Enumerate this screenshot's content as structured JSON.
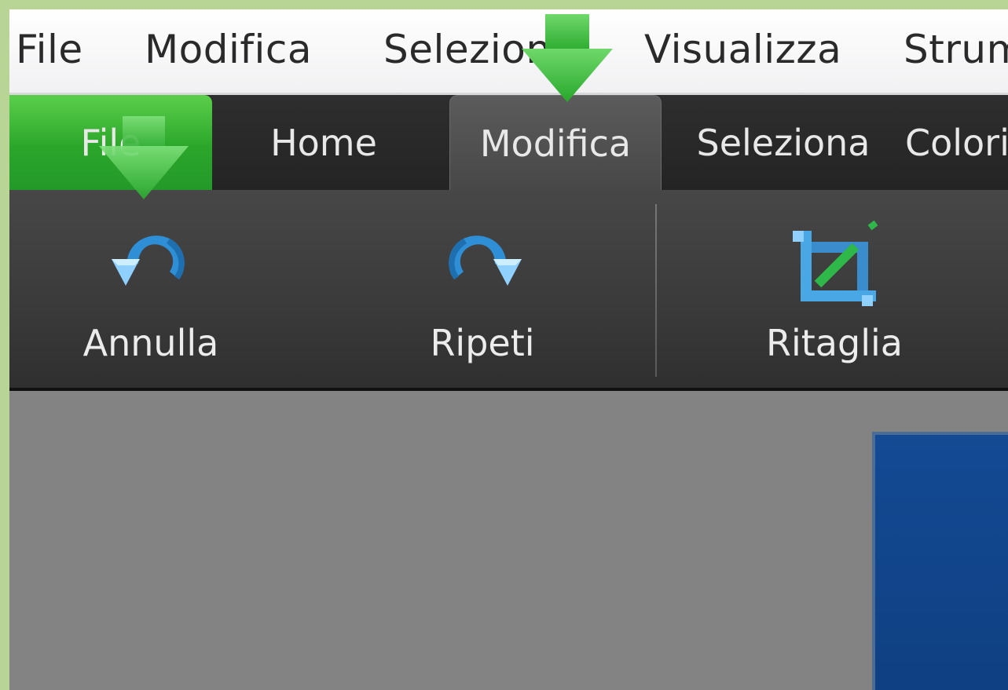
{
  "menubar": {
    "items": [
      "File",
      "Modifica",
      "Seleziona",
      "Visualizza",
      "Strumenti"
    ]
  },
  "ribbon_tabs": [
    "File",
    "Home",
    "Modifica",
    "Seleziona",
    "Colori"
  ],
  "active_tab": "Modifica",
  "ribbon": {
    "undo_label": "Annulla",
    "redo_label": "Ripeti",
    "crop_label": "Ritaglia"
  },
  "colors": {
    "file_tab": "#2ba62a",
    "ribbon_bg": "#3a3a3a",
    "canvas_bg": "#838383",
    "document": "#134a93",
    "hint_arrow": "#3fb83d"
  },
  "icons": [
    "undo-icon",
    "redo-icon",
    "crop-icon",
    "down-arrow-icon"
  ]
}
